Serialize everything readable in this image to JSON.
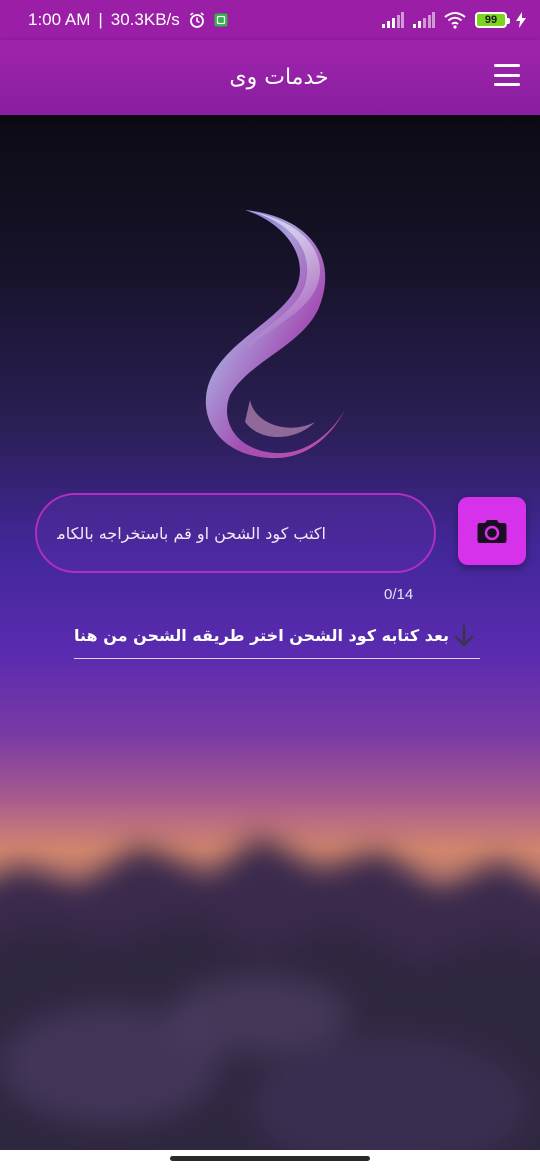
{
  "status_bar": {
    "time": "1:00 AM",
    "separator": "|",
    "network_speed": "30.3KB/s",
    "battery_level": "99",
    "icons": [
      "alarm-icon",
      "app-notification-icon",
      "signal-icon",
      "signal-icon",
      "wifi-icon",
      "battery-icon",
      "charging-icon"
    ]
  },
  "app_bar": {
    "title": "خدمات وى",
    "menu_icon": "hamburger-menu-icon"
  },
  "recharge": {
    "input_placeholder": "اكتب كود الشحن او قم باستخراجه بالكاميرا",
    "input_value": "",
    "counter": "0/14",
    "camera_icon": "camera-icon",
    "method_label": "بعد كتابه كود الشحن اختر طريقه الشحن من هنا",
    "method_icon": "arrow-down-icon"
  },
  "colors": {
    "app_bar": "#9a1fa6",
    "accent": "#d632ec",
    "input_border": "#b12ec0"
  }
}
